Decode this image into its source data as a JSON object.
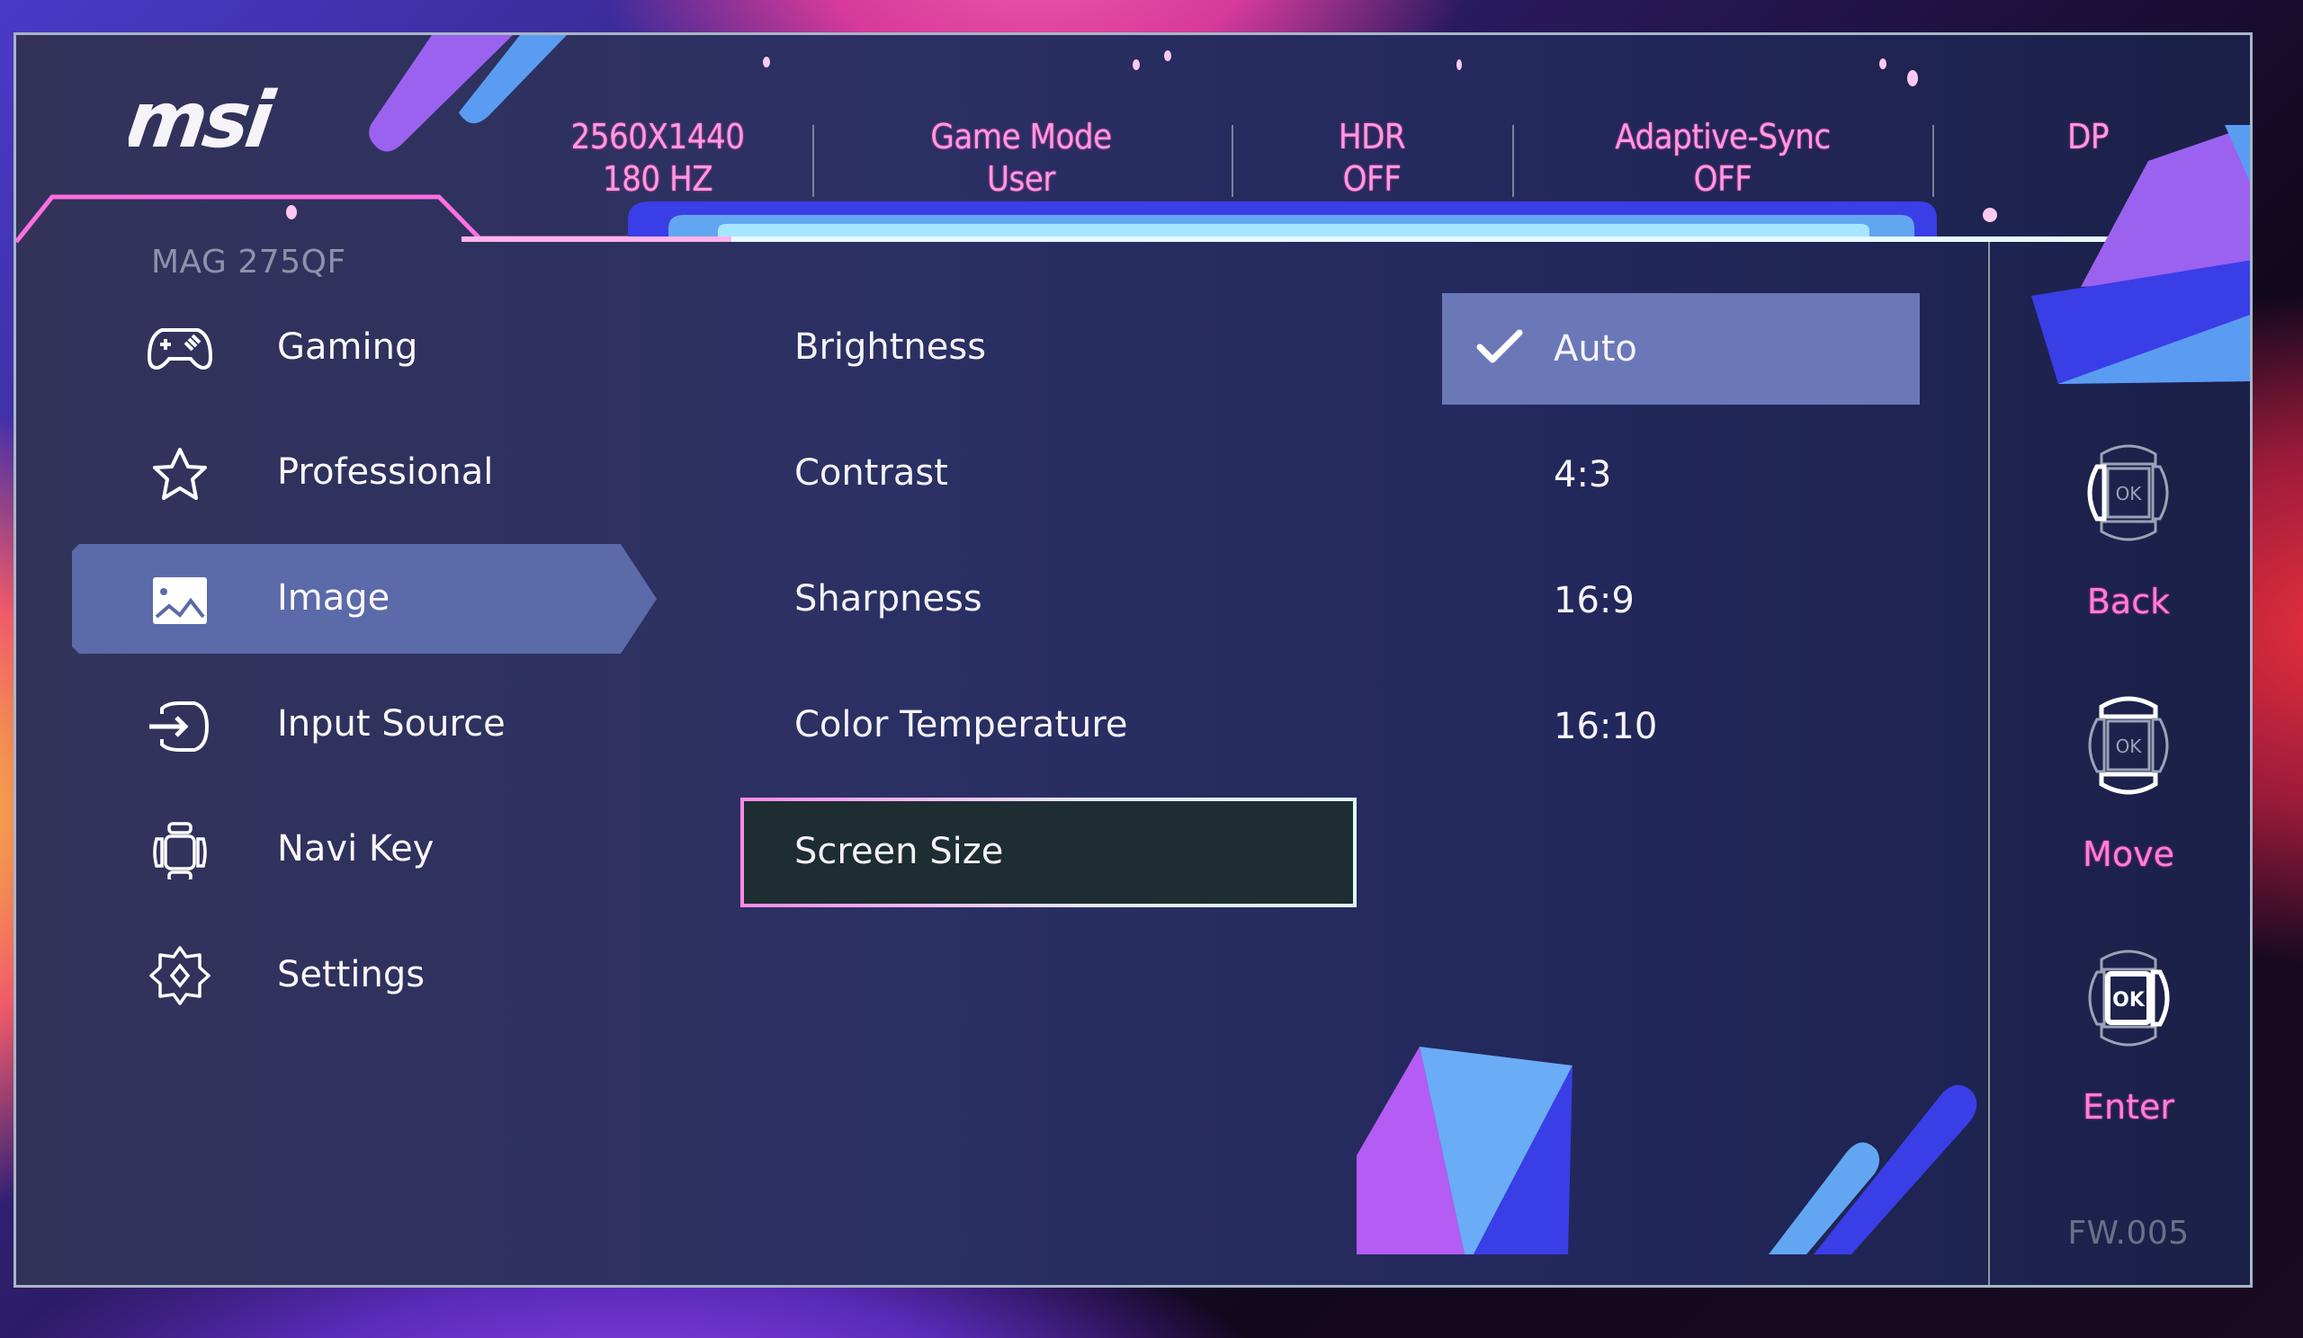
{
  "brand": {
    "logo_text": "msi",
    "model": "MAG 275QF"
  },
  "status_bar": [
    {
      "id": "resolution",
      "line1": "2560X1440",
      "line2": "180 HZ"
    },
    {
      "id": "game-mode",
      "line1": "Game Mode",
      "line2": "User"
    },
    {
      "id": "hdr",
      "line1": "HDR",
      "line2": "OFF"
    },
    {
      "id": "adaptive-sync",
      "line1": "Adaptive-Sync",
      "line2": "OFF"
    },
    {
      "id": "input",
      "line1": "DP",
      "line2": ""
    }
  ],
  "sidebar": {
    "items": [
      {
        "label": "Gaming",
        "icon": "gamepad-icon",
        "selected": false
      },
      {
        "label": "Professional",
        "icon": "star-icon",
        "selected": false
      },
      {
        "label": "Image",
        "icon": "image-icon",
        "selected": true
      },
      {
        "label": "Input Source",
        "icon": "input-source-icon",
        "selected": false
      },
      {
        "label": "Navi Key",
        "icon": "navi-key-icon",
        "selected": false
      },
      {
        "label": "Settings",
        "icon": "gear-icon",
        "selected": false
      }
    ]
  },
  "options": {
    "items": [
      {
        "label": "Brightness",
        "focused": false
      },
      {
        "label": "Contrast",
        "focused": false
      },
      {
        "label": "Sharpness",
        "focused": false
      },
      {
        "label": "Color Temperature",
        "focused": false
      },
      {
        "label": "Screen Size",
        "focused": true
      }
    ]
  },
  "values": {
    "items": [
      {
        "label": "Auto",
        "selected": true,
        "icon": "checkmark-icon"
      },
      {
        "label": "4:3",
        "selected": false
      },
      {
        "label": "16:9",
        "selected": false
      },
      {
        "label": "16:10",
        "selected": false
      }
    ]
  },
  "hints": [
    {
      "label": "Back",
      "icon": "navi-key-left-icon"
    },
    {
      "label": "Move",
      "icon": "navi-key-up-down-icon"
    },
    {
      "label": "Enter",
      "icon": "navi-key-ok-icon"
    }
  ],
  "firmware": "FW.005",
  "colors": {
    "accent_pink": "#ff8ae0",
    "selected_bg": "#6a78b8",
    "focus_bg": "#1d2d31",
    "panel_bg": "#2a2f62"
  }
}
